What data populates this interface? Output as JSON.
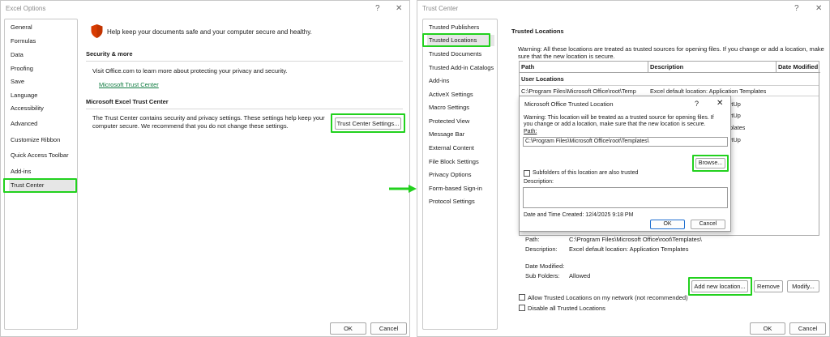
{
  "left_window": {
    "title": "Excel Options",
    "help": "?",
    "close": "✕",
    "nav": [
      "General",
      "Formulas",
      "Data",
      "Proofing",
      "Save",
      "Language",
      "Accessibility",
      "Advanced",
      "Customize Ribbon",
      "Quick Access Toolbar",
      "Add-ins",
      "Trust Center"
    ],
    "selected_nav": "Trust Center",
    "header_text": "Help keep your documents safe and your computer secure and healthy.",
    "security_heading": "Security & more",
    "security_text": "Visit Office.com to learn more about protecting your privacy and security.",
    "security_link": "Microsoft Trust Center",
    "tc_heading": "Microsoft Excel Trust Center",
    "tc_text_1": "The Trust Center contains security and privacy settings. These settings help keep your",
    "tc_text_2": "computer secure. We recommend that you do not change these settings.",
    "tc_button": "Trust Center Settings...",
    "ok": "OK",
    "cancel": "Cancel"
  },
  "right_window": {
    "title": "Trust Center",
    "help": "?",
    "close": "✕",
    "nav": [
      "Trusted Publishers",
      "Trusted Locations",
      "Trusted Documents",
      "Trusted Add-in Catalogs",
      "Add-ins",
      "ActiveX Settings",
      "Macro Settings",
      "Protected View",
      "Message Bar",
      "External Content",
      "File Block Settings",
      "Privacy Options",
      "Form-based Sign-in",
      "Protocol Settings"
    ],
    "selected_nav": "Trusted Locations",
    "heading": "Trusted Locations",
    "warning_1": "Warning: All these locations are treated as trusted sources for opening files.  If you change or add a location, make",
    "warning_2": "sure that the new location is secure.",
    "table": {
      "headers": [
        "Path",
        "Description",
        "Date Modified"
      ],
      "section": "User Locations",
      "row_path": "C:\\Program Files\\Microsoft Office\\root\\Temp",
      "row_desc": "Excel default location: Application Templates",
      "partial_rows": [
        "rtUp",
        "rtUp",
        "plates",
        "rtUp"
      ]
    },
    "details": {
      "path_label": "Path:",
      "path_value": "C:\\Program Files\\Microsoft Office\\root\\Templates\\",
      "desc_label": "Description:",
      "desc_value": "Excel default location: Application Templates",
      "date_label": "Date Modified:",
      "sub_label": "Sub Folders:",
      "sub_value": "Allowed"
    },
    "add_button": "Add new location...",
    "remove_button": "Remove",
    "modify_button": "Modify...",
    "allow_network": "Allow Trusted Locations on my network (not recommended)",
    "disable_all": "Disable all Trusted Locations",
    "ok": "OK",
    "cancel": "Cancel"
  },
  "modal": {
    "title": "Microsoft Office Trusted Location",
    "help": "?",
    "close": "✕",
    "warning_1": "Warning: This location will be treated as a trusted source for opening files. If",
    "warning_2": "you change or add a location, make sure that the new location is secure.",
    "path_label": "Path:",
    "path_value": "C:\\Program Files\\Microsoft Office\\root\\Templates\\",
    "browse": "Browse...",
    "subfolders": "Subfolders of this location are also trusted",
    "description_label": "Description:",
    "date_created": "Date and Time Created:   12/4/2025 9:18 PM",
    "ok": "OK",
    "cancel": "Cancel"
  },
  "colors": {
    "highlight": "#22d11e",
    "shield": "#d83b01",
    "link": "#107c41",
    "primary_border": "#1e6fd0"
  }
}
